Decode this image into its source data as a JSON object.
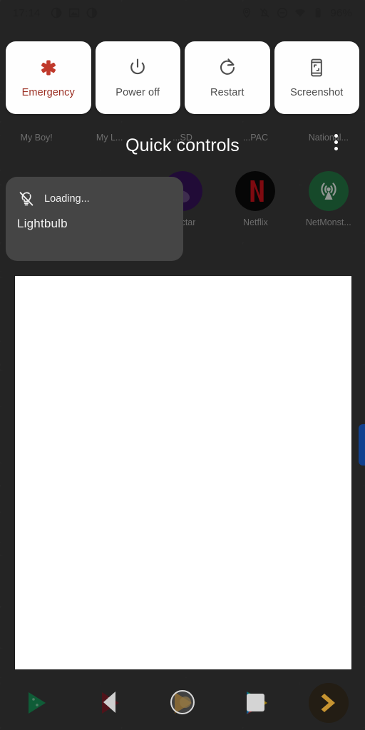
{
  "statusbar": {
    "time": "17:14",
    "left_icons": [
      "app-notification-icon",
      "image-notification-icon",
      "app-notification-icon-2"
    ],
    "right_icons": [
      "location-icon",
      "notifications-muted-icon",
      "do-not-disturb-icon",
      "wifi-icon",
      "battery-icon"
    ],
    "battery_percent": "96%"
  },
  "power_actions": [
    {
      "id": "emergency",
      "label": "Emergency",
      "icon": "star-of-life-icon",
      "color": "#9b2f23"
    },
    {
      "id": "power-off",
      "label": "Power off",
      "icon": "power-icon",
      "color": "#4d4d4d"
    },
    {
      "id": "restart",
      "label": "Restart",
      "icon": "restart-icon",
      "color": "#4d4d4d"
    },
    {
      "id": "screenshot",
      "label": "Screenshot",
      "icon": "screenshot-icon",
      "color": "#4d4d4d"
    }
  ],
  "quick_controls": {
    "title": "Quick controls",
    "overflow_icon": "more-vertical-icon",
    "tile": {
      "name": "Lightbulb",
      "status": "Loading...",
      "icon": "lightbulb-off-icon"
    }
  },
  "home_screen": {
    "app_labels_row": [
      "My Boy!",
      "My L...",
      "...SD",
      "...PAC",
      "National..."
    ],
    "apps": [
      {
        "name": "Nectar",
        "icon": "nectar-icon"
      },
      {
        "name": "Netflix",
        "icon": "netflix-icon"
      },
      {
        "name": "NetMonst...",
        "icon": "netmonster-icon"
      }
    ],
    "dock": [
      {
        "name": "play-games-icon"
      },
      {
        "name": "play-movies-icon"
      },
      {
        "name": "play-music-icon"
      },
      {
        "name": "play-store-icon"
      },
      {
        "name": "chevron-app-icon"
      }
    ]
  },
  "navbar": {
    "back": "back-icon",
    "home": "home-icon",
    "recents": "recents-icon"
  },
  "colors": {
    "scrim": "#393939",
    "card_bg": "#fefefe",
    "tile_bg": "#454545",
    "accent_blue": "#11418f",
    "emergency_red": "#c0392b"
  }
}
